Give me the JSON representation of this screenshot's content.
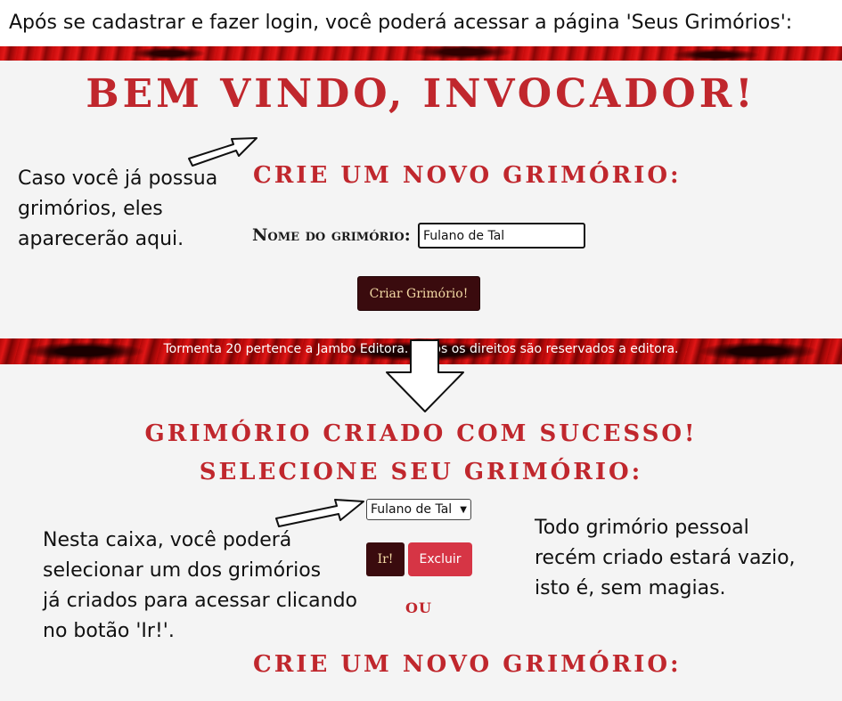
{
  "caption": {
    "top": "Após se cadastrar e fazer login, você poderá acessar a página 'Seus Grimórios':"
  },
  "page1": {
    "welcome_title": "BEM VINDO, INVOCADOR!",
    "create_heading": "CRIE UM NOVO GRIMÓRIO:",
    "name_label": "Nome do grimório:",
    "name_value": "Fulano de Tal",
    "create_button": "Criar Grimório!",
    "footer": "Tormenta 20 pertence a Jambo Editora. Todos os direitos são reservados a editora."
  },
  "page2": {
    "success_heading": "GRIMÓRIO CRIADO COM SUCESSO!",
    "select_heading": "SELECIONE SEU GRIMÓRIO:",
    "select_value": "Fulano de Tal",
    "go_button": "Ir!",
    "delete_button": "Excluir",
    "or_text": "OU",
    "create_heading": "CRIE UM NOVO GRIMÓRIO:"
  },
  "annotations": {
    "existing": [
      "Caso você já possua",
      "grimórios, eles",
      "aparecerão aqui."
    ],
    "select_help": [
      "Nesta caixa, você poderá",
      "selecionar um dos grimórios",
      "já criados para acessar clicando",
      "no botão 'Ir!'."
    ],
    "empty_note": [
      "Todo grimório pessoal",
      "recém criado estará vazio,",
      "isto é, sem magias."
    ]
  },
  "icons": [
    "arrow-right-icon",
    "arrow-down-icon",
    "chevron-down-icon"
  ],
  "colors": {
    "title_red": "#c0272d",
    "dark_button": "#3a0b0e",
    "delete_button": "#d63545"
  }
}
